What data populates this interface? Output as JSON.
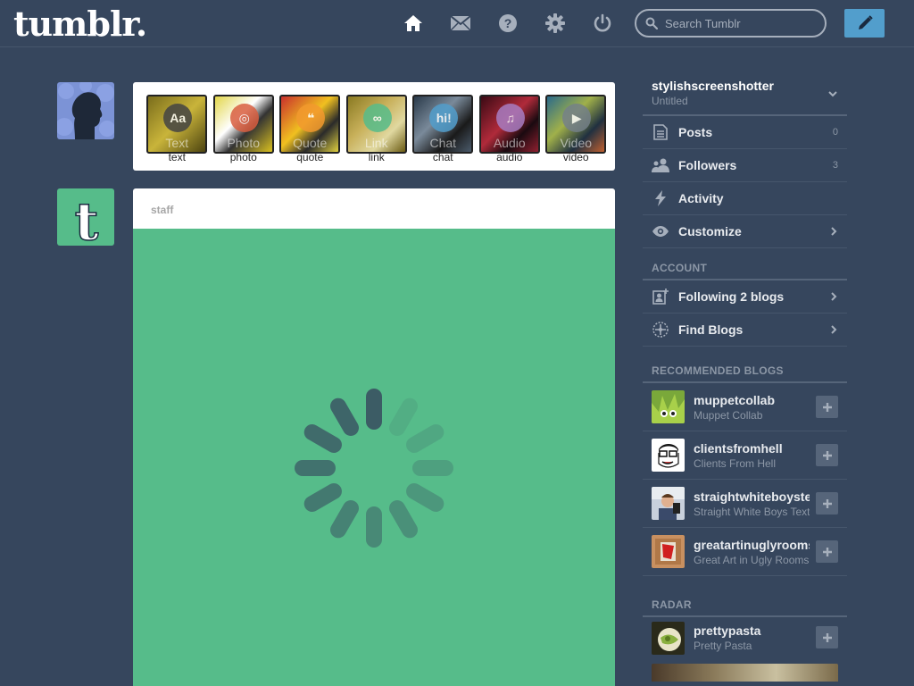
{
  "header": {
    "logo": "tumblr.",
    "search_placeholder": "Search Tumblr"
  },
  "post_types": [
    {
      "label": "text",
      "ghost": "Text",
      "glyph": "Aa",
      "color": "#444"
    },
    {
      "label": "photo",
      "ghost": "Photo",
      "glyph": "◎",
      "color": "#d95e40"
    },
    {
      "label": "quote",
      "ghost": "Quote",
      "glyph": "❝",
      "color": "#f2992e"
    },
    {
      "label": "link",
      "ghost": "Link",
      "glyph": "∞",
      "color": "#56bc8a"
    },
    {
      "label": "chat",
      "ghost": "Chat",
      "glyph": "hi!",
      "color": "#529ecc"
    },
    {
      "label": "audio",
      "ghost": "Audio",
      "glyph": "♫",
      "color": "#a77dc2"
    },
    {
      "label": "video",
      "ghost": "Video",
      "glyph": "▶",
      "color": "#748089"
    }
  ],
  "post": {
    "author": "staff",
    "body_color": "#56bc8a"
  },
  "sidebar": {
    "blog_name": "stylishscreenshotter",
    "blog_title": "Untitled",
    "items": [
      {
        "label": "Posts",
        "count": "0"
      },
      {
        "label": "Followers",
        "count": "3"
      },
      {
        "label": "Activity"
      },
      {
        "label": "Customize"
      }
    ],
    "account_heading": "ACCOUNT",
    "account_items": [
      {
        "label": "Following 2 blogs"
      },
      {
        "label": "Find Blogs"
      }
    ],
    "recommended_heading": "RECOMMENDED BLOGS",
    "recommended": [
      {
        "name": "muppetcollab",
        "title": "Muppet Collab"
      },
      {
        "name": "clientsfromhell",
        "title": "Clients From Hell"
      },
      {
        "name": "straightwhiteboystexting",
        "title": "Straight White Boys Texting"
      },
      {
        "name": "greatartinuglyrooms",
        "title": "Great Art in Ugly Rooms"
      }
    ],
    "radar_heading": "RADAR",
    "radar": [
      {
        "name": "prettypasta",
        "title": "Pretty Pasta"
      }
    ]
  },
  "colors": {
    "background": "#36465d",
    "accent": "#529ecc",
    "post_green": "#56bc8a"
  }
}
